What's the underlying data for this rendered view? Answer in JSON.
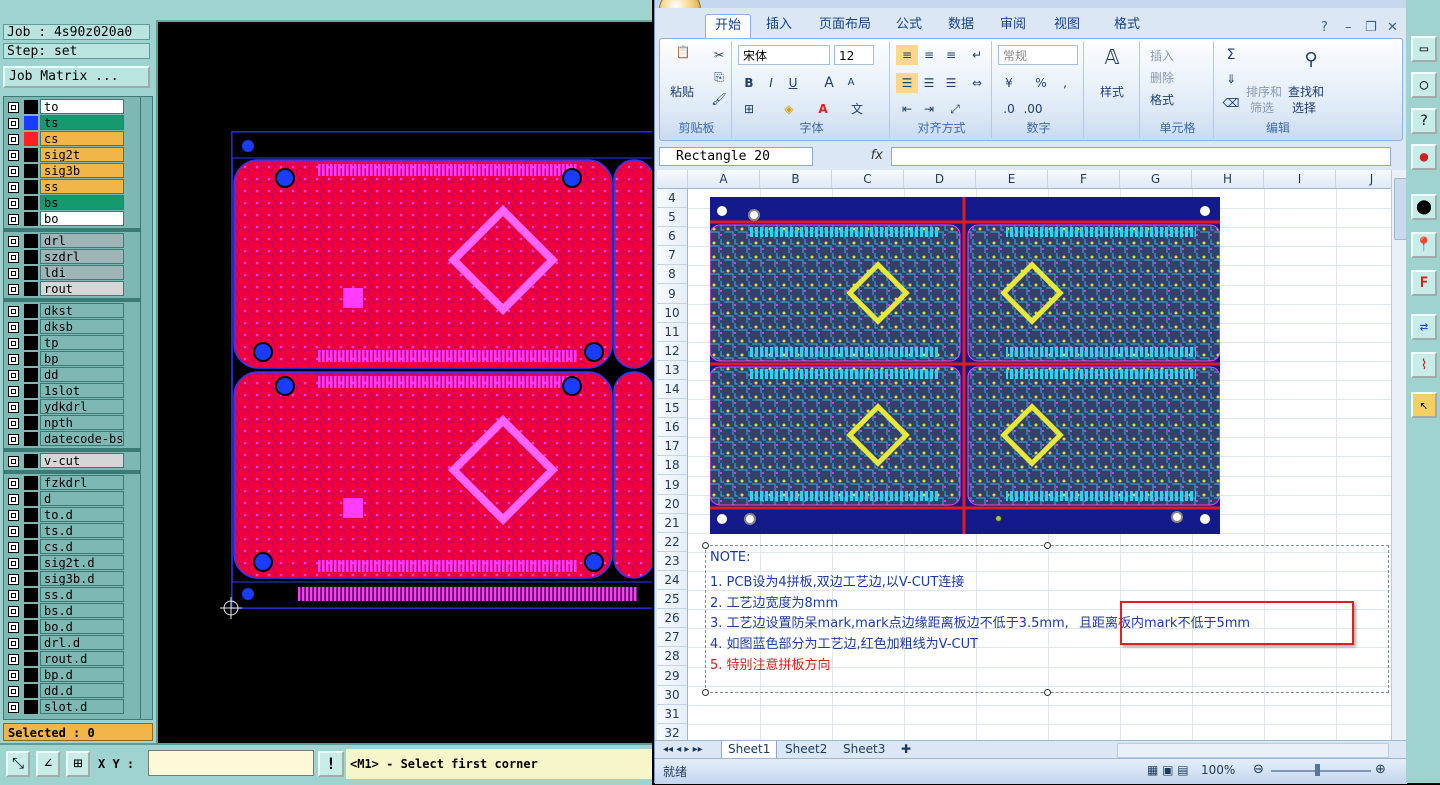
{
  "cam": {
    "job_label": "Job : 4s90z020a0",
    "step_label": "Step: set",
    "job_matrix_button": "Job Matrix ...",
    "layers": [
      {
        "name": "to",
        "color": "#ffffff",
        "swatch": "#000000"
      },
      {
        "name": "ts",
        "color": "#149a6e",
        "swatch": "#1a3cff"
      },
      {
        "name": "cs",
        "color": "#f2b548",
        "swatch": "#ff2020"
      },
      {
        "name": "sig2t",
        "color": "#f2b548",
        "swatch": "#000000"
      },
      {
        "name": "sig3b",
        "color": "#f2b548",
        "swatch": "#000000"
      },
      {
        "name": "ss",
        "color": "#f2b548",
        "swatch": "#000000"
      },
      {
        "name": "bs",
        "color": "#149a6e",
        "swatch": "#000000"
      },
      {
        "name": "bo",
        "color": "#ffffff",
        "swatch": "#000000"
      },
      {
        "name": "drl",
        "color": "#9fb4b6",
        "swatch": "#000000"
      },
      {
        "name": "szdrl",
        "color": "#9fb4b6",
        "swatch": "#000000"
      },
      {
        "name": "ldi",
        "color": "#9fb4b6",
        "swatch": "#000000"
      },
      {
        "name": "rout",
        "color": "#d6d6d6",
        "swatch": "#000000"
      },
      {
        "name": "dkst",
        "color": "#7db8b4",
        "swatch": "#000000"
      },
      {
        "name": "dksb",
        "color": "#7db8b4",
        "swatch": "#000000"
      },
      {
        "name": "tp",
        "color": "#7db8b4",
        "swatch": "#000000"
      },
      {
        "name": "bp",
        "color": "#7db8b4",
        "swatch": "#000000"
      },
      {
        "name": "dd",
        "color": "#7db8b4",
        "swatch": "#000000"
      },
      {
        "name": "1slot",
        "color": "#7db8b4",
        "swatch": "#000000"
      },
      {
        "name": "ydkdrl",
        "color": "#7db8b4",
        "swatch": "#000000"
      },
      {
        "name": "npth",
        "color": "#7db8b4",
        "swatch": "#000000"
      },
      {
        "name": "datecode-bs",
        "color": "#7db8b4",
        "swatch": "#000000"
      },
      {
        "name": "v-cut",
        "color": "#d6d6d6",
        "swatch": "#000000"
      },
      {
        "name": "fzkdrl",
        "color": "#7db8b4",
        "swatch": "#000000"
      },
      {
        "name": "d",
        "color": "#7db8b4",
        "swatch": "#000000"
      },
      {
        "name": "to.d",
        "color": "#7db8b4",
        "swatch": "#000000"
      },
      {
        "name": "ts.d",
        "color": "#7db8b4",
        "swatch": "#000000"
      },
      {
        "name": "cs.d",
        "color": "#7db8b4",
        "swatch": "#000000"
      },
      {
        "name": "sig2t.d",
        "color": "#7db8b4",
        "swatch": "#000000"
      },
      {
        "name": "sig3b.d",
        "color": "#7db8b4",
        "swatch": "#000000"
      },
      {
        "name": "ss.d",
        "color": "#7db8b4",
        "swatch": "#000000"
      },
      {
        "name": "bs.d",
        "color": "#7db8b4",
        "swatch": "#000000"
      },
      {
        "name": "bo.d",
        "color": "#7db8b4",
        "swatch": "#000000"
      },
      {
        "name": "drl.d",
        "color": "#7db8b4",
        "swatch": "#000000"
      },
      {
        "name": "rout.d",
        "color": "#7db8b4",
        "swatch": "#000000"
      },
      {
        "name": "bp.d",
        "color": "#7db8b4",
        "swatch": "#000000"
      },
      {
        "name": "dd.d",
        "color": "#7db8b4",
        "swatch": "#000000"
      },
      {
        "name": "slot.d",
        "color": "#7db8b4",
        "swatch": "#000000"
      }
    ],
    "selected_label": "Selected : 0",
    "xy_label": "X Y :",
    "xy_value": "",
    "warn_icon": "!",
    "prompt": "<M1> - Select first corner"
  },
  "excel": {
    "tabs": [
      "开始",
      "插入",
      "页面布局",
      "公式",
      "数据",
      "审阅",
      "视图",
      "格式"
    ],
    "active_tab": 0,
    "ribbon": {
      "clipboard": {
        "label": "剪贴板",
        "paste": "粘贴"
      },
      "font": {
        "label": "字体",
        "font_name": "宋体",
        "font_size": "12",
        "bold": "B",
        "italic": "I",
        "underline": "U",
        "grow": "A",
        "shrink": "A"
      },
      "alignment": {
        "label": "对齐方式"
      },
      "number": {
        "label": "数字",
        "format": "常规",
        "percent": "%"
      },
      "styles": {
        "label": "样式"
      },
      "cells": {
        "label": "单元格",
        "insert": "插入",
        "delete": "删除",
        "format": "格式"
      },
      "editing": {
        "label": "编辑",
        "sigma": "Σ",
        "sort_filter_1": "排序和",
        "sort_filter_2": "筛选",
        "find_select_1": "查找和",
        "find_select_2": "选择"
      }
    },
    "name_box": "Rectangle 20",
    "formula_label": "fx",
    "formula_value": "",
    "columns": [
      "A",
      "B",
      "C",
      "D",
      "E",
      "F",
      "G",
      "H",
      "I",
      "J"
    ],
    "rows": [
      "4",
      "5",
      "6",
      "7",
      "8",
      "9",
      "10",
      "11",
      "12",
      "13",
      "14",
      "15",
      "16",
      "17",
      "18",
      "19",
      "20",
      "21",
      "22",
      "23",
      "24",
      "25",
      "26",
      "27",
      "28",
      "29",
      "30",
      "31",
      "32"
    ],
    "note": {
      "title": "NOTE:",
      "line1": "1. PCB设为4拼板,双边工艺边,以V-CUT连接",
      "line2": "2. 工艺边宽度为8mm",
      "line3": "3. 工艺边设置防呆mark,mark点边缘距离板边不低于3.5mm,",
      "line3_highlight": "且距离板内mark不低于5mm",
      "line4": "4. 如图蓝色部分为工艺边,红色加粗线为V-CUT",
      "line5": "5. 特别注意拼板方向",
      "line5_color": "#d42020",
      "highlight_color": "#e02020"
    },
    "sheets": [
      "Sheet1",
      "Sheet2",
      "Sheet3"
    ],
    "active_sheet": 0,
    "status": "就绪",
    "zoom": "100%"
  },
  "right_strip": {
    "icons": [
      "rectangle-tool-icon",
      "circle-tool-icon",
      "help-icon",
      "traffic-light-icon",
      "fill-pad-icon",
      "pin-icon",
      "label-icon",
      "swap-icon",
      "flag-icon",
      "measure-icon",
      "pointer-icon"
    ]
  }
}
